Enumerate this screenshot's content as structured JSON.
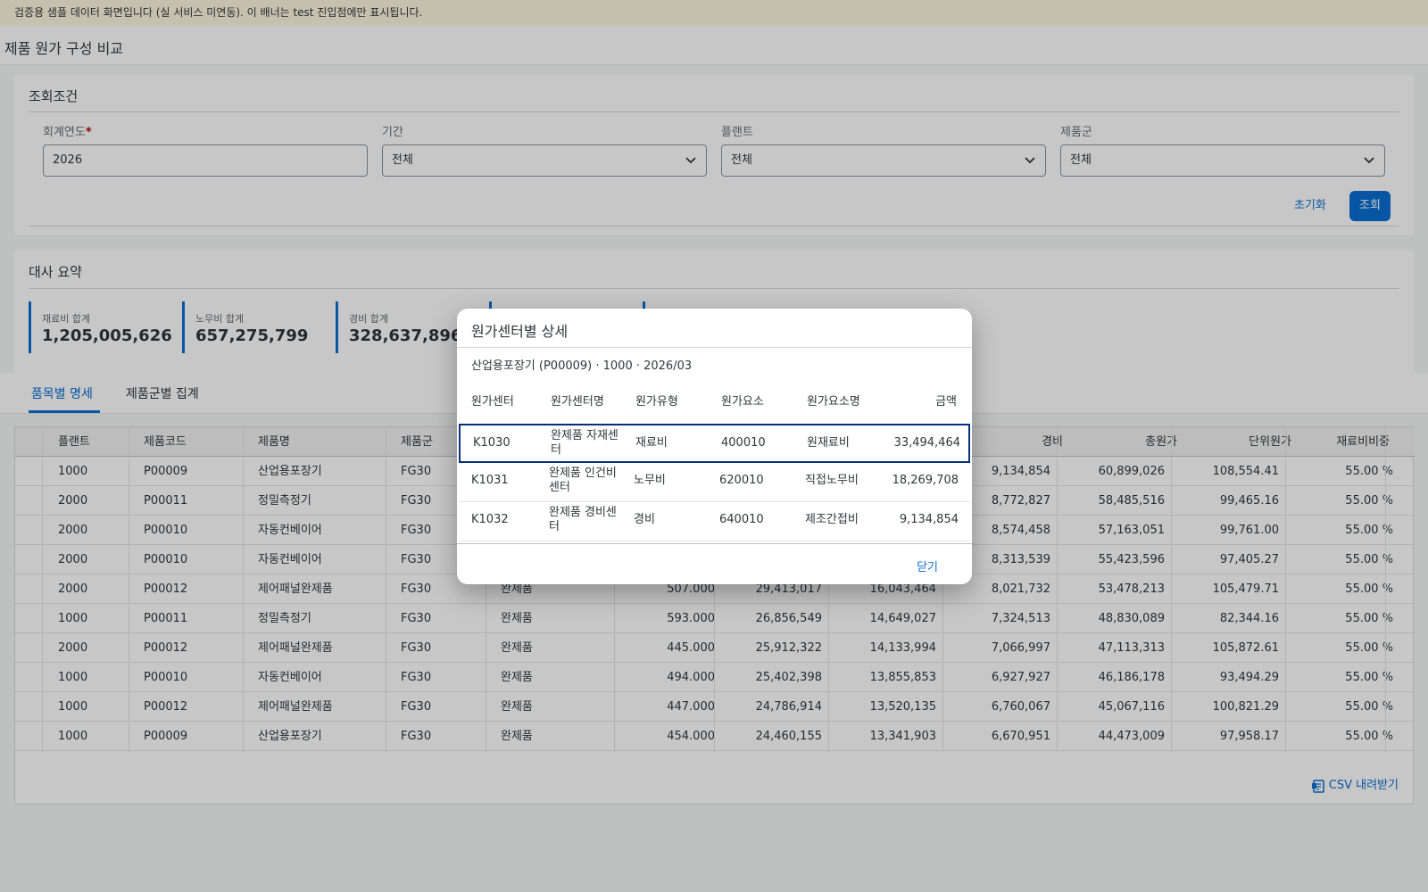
{
  "banner": {
    "text": "검증용 샘플 데이터 화면입니다 (실 서비스 미연동). 이 배너는 test 진입점에만 표시됩니다."
  },
  "page": {
    "title": "제품 원가 구성 비교"
  },
  "filters": {
    "title": "조회조건",
    "fiscal_year": {
      "label": "회계연도",
      "value": "2026",
      "required_mark": "*"
    },
    "period": {
      "label": "기간",
      "value": "전체"
    },
    "plant": {
      "label": "플랜트",
      "value": "전체"
    },
    "product_group": {
      "label": "제품군",
      "value": "전체"
    },
    "reset_label": "초기화",
    "search_label": "조회"
  },
  "summary": {
    "title": "대사 요약",
    "kpis": [
      {
        "label": "재료비 합계",
        "value": "1,205,005,626"
      },
      {
        "label": "노무비 합계",
        "value": "657,275,799"
      },
      {
        "label": "경비 합계",
        "value": "328,637,896"
      }
    ]
  },
  "tabs": [
    {
      "label": "품목별 명세",
      "active": true
    },
    {
      "label": "제품군별 집계",
      "active": false
    }
  ],
  "table": {
    "headers": [
      "플랜트",
      "제품코드",
      "제품명",
      "제품군",
      "",
      "",
      "",
      "",
      "경비",
      "총원가",
      "단위원가",
      "재료비비중"
    ],
    "rows": [
      [
        "1000",
        "P00009",
        "산업용포장기",
        "FG30",
        "",
        "",
        "",
        "",
        "9,134,854",
        "60,899,026",
        "108,554.41",
        "55.00 %"
      ],
      [
        "2000",
        "P00011",
        "정밀측정기",
        "FG30",
        "",
        "",
        "",
        "",
        "8,772,827",
        "58,485,516",
        "99,465.16",
        "55.00 %"
      ],
      [
        "2000",
        "P00010",
        "자동컨베이어",
        "FG30",
        "",
        "",
        "",
        "",
        "8,574,458",
        "57,163,051",
        "99,761.00",
        "55.00 %"
      ],
      [
        "2000",
        "P00010",
        "자동컨베이어",
        "FG30",
        "",
        "",
        "",
        "",
        "8,313,539",
        "55,423,596",
        "97,405.27",
        "55.00 %"
      ],
      [
        "2000",
        "P00012",
        "제어패널완제품",
        "FG30",
        "완제품",
        "507.000",
        "29,413,017",
        "16,043,464",
        "8,021,732",
        "53,478,213",
        "105,479.71",
        "55.00 %"
      ],
      [
        "1000",
        "P00011",
        "정밀측정기",
        "FG30",
        "완제품",
        "593.000",
        "26,856,549",
        "14,649,027",
        "7,324,513",
        "48,830,089",
        "82,344.16",
        "55.00 %"
      ],
      [
        "2000",
        "P00012",
        "제어패널완제품",
        "FG30",
        "완제품",
        "445.000",
        "25,912,322",
        "14,133,994",
        "7,066,997",
        "47,113,313",
        "105,872.61",
        "55.00 %"
      ],
      [
        "1000",
        "P00010",
        "자동컨베이어",
        "FG30",
        "완제품",
        "494.000",
        "25,402,398",
        "13,855,853",
        "6,927,927",
        "46,186,178",
        "93,494.29",
        "55.00 %"
      ],
      [
        "1000",
        "P00012",
        "제어패널완제품",
        "FG30",
        "완제품",
        "447.000",
        "24,786,914",
        "13,520,135",
        "6,760,067",
        "45,067,116",
        "100,821.29",
        "55.00 %"
      ],
      [
        "1000",
        "P00009",
        "산업용포장기",
        "FG30",
        "완제품",
        "454.000",
        "24,460,155",
        "13,341,903",
        "6,670,951",
        "44,473,009",
        "97,958.17",
        "55.00 %"
      ]
    ],
    "csv_label": "CSV 내려받기"
  },
  "dialog": {
    "title": "원가센터별 상세",
    "subtitle": "산업용포장기 (P00009) · 1000 · 2026/03",
    "headers": [
      "원가센터",
      "원가센터명",
      "원가유형",
      "원가요소",
      "원가요소명",
      "금액"
    ],
    "rows": [
      [
        "K1030",
        "완제품 자재센터",
        "재료비",
        "400010",
        "원재료비",
        "33,494,464"
      ],
      [
        "K1031",
        "완제품 인건비센터",
        "노무비",
        "620010",
        "직접노무비",
        "18,269,708"
      ],
      [
        "K1032",
        "완제품 경비센터",
        "경비",
        "640010",
        "제조간접비",
        "9,134,854"
      ]
    ],
    "close_label": "닫기"
  }
}
